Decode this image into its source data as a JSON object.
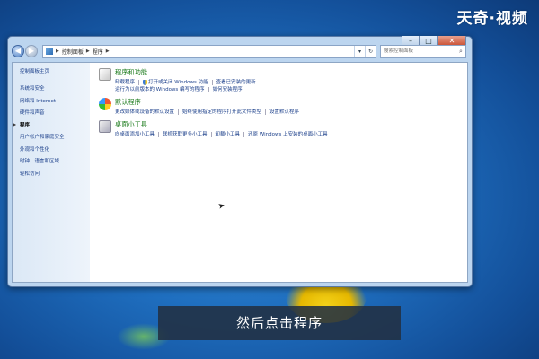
{
  "logo": "天奇·视频",
  "window": {
    "address": {
      "crumbs": [
        "控制面板",
        "程序"
      ]
    },
    "search": {
      "placeholder": "搜索控制面板"
    }
  },
  "sidebar": {
    "home": "控制面板主页",
    "items": [
      "系统和安全",
      "网络和 Internet",
      "硬件和声音",
      "程序",
      "用户帐户和家庭安全",
      "外观和个性化",
      "时钟、语言和区域",
      "轻松访问"
    ],
    "active": "程序"
  },
  "categories": [
    {
      "title": "程序和功能",
      "links": [
        "卸载程序",
        "打开或关闭 Windows 功能",
        "查看已安装的更新",
        "运行为以前版本的 Windows 编写的程序",
        "如何安装程序"
      ]
    },
    {
      "title": "默认程序",
      "links": [
        "更改媒体或设备的默认设置",
        "始终使用指定的程序打开此文件类型",
        "设置默认程序"
      ]
    },
    {
      "title": "桌面小工具",
      "links": [
        "向桌面添加小工具",
        "联机获取更多小工具",
        "卸载小工具",
        "还原 Windows 上安装的桌面小工具"
      ]
    }
  ],
  "caption": "然后点击程序"
}
